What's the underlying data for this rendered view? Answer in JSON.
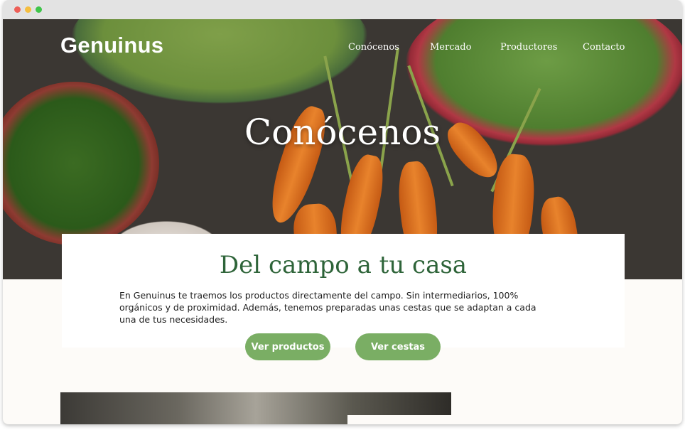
{
  "brand": {
    "logo": "Genuinus"
  },
  "nav": {
    "items": [
      {
        "label": "Conócenos"
      },
      {
        "label": "Mercado"
      },
      {
        "label": "Productores"
      },
      {
        "label": "Contacto"
      }
    ]
  },
  "hero": {
    "title": "Conócenos"
  },
  "intro": {
    "title": "Del campo a tu casa",
    "text": "En Genuinus te traemos los productos directamente del campo. Sin intermediarios, 100% orgánicos y de proximidad. Además, tenemos preparadas unas cestas que se adaptan a cada una de tus necesidades.",
    "buttons": {
      "products": "Ver productos",
      "baskets": "Ver cestas"
    }
  },
  "colors": {
    "accent_green": "#7aae64",
    "title_green": "#2e6439"
  }
}
